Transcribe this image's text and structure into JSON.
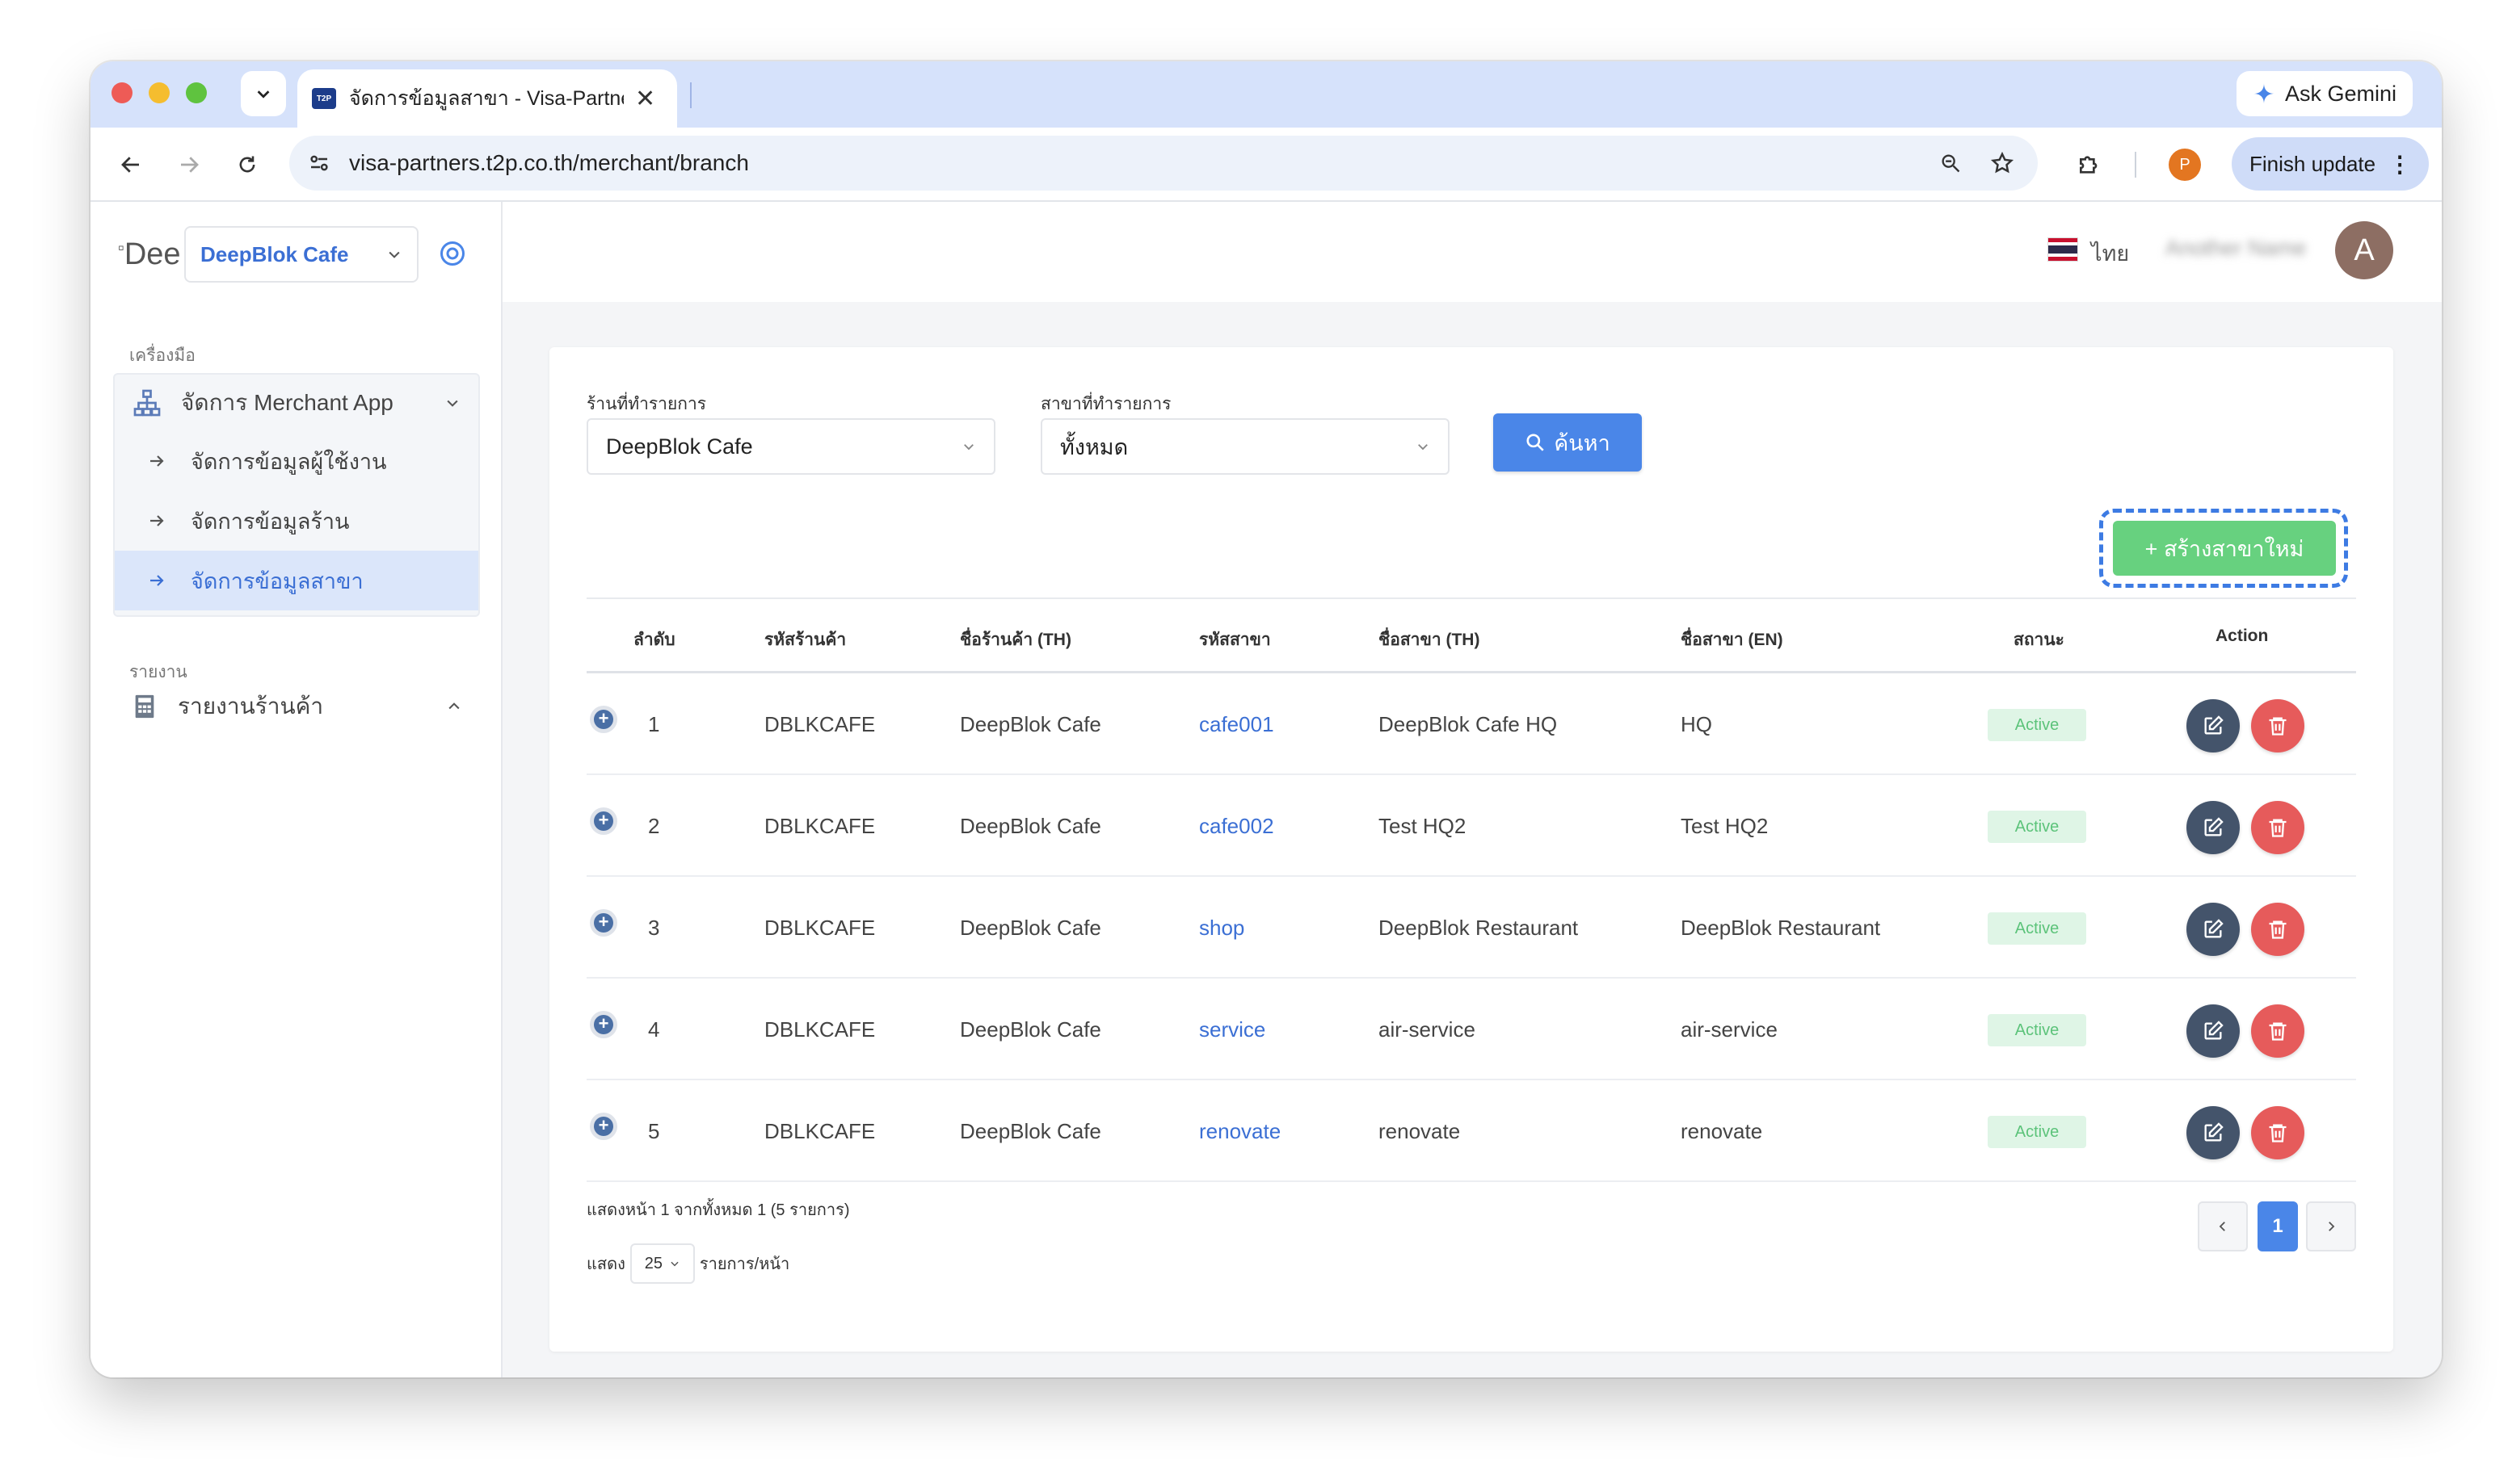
{
  "browser": {
    "tab_title": "จัดการข้อมูลสาขา - Visa-Partners",
    "tab_favicon_text": "T2P",
    "url": "visa-partners.t2p.co.th/merchant/branch",
    "ask_gemini": "Ask Gemini",
    "profile_initial": "P",
    "finish_update": "Finish update"
  },
  "sidebar": {
    "logo_alt": "DeepBlok",
    "store_name": "DeepBlok Cafe",
    "section_tools": "เครื่องมือ",
    "group_label": "จัดการ Merchant App",
    "sub_items": [
      {
        "label": "จัดการข้อมูลผู้ใช้งาน"
      },
      {
        "label": "จัดการข้อมูลร้าน"
      },
      {
        "label": "จัดการข้อมูลสาขา"
      }
    ],
    "section_reports": "รายงาน",
    "report_label": "รายงานร้านค้า"
  },
  "header": {
    "language": "ไทย",
    "user_name": "Another Name",
    "avatar_initial": "A"
  },
  "filters": {
    "store_label": "ร้านที่ทำรายการ",
    "store_value": "DeepBlok Cafe",
    "branch_label": "สาขาที่ทำรายการ",
    "branch_value": "ทั้งหมด",
    "search_button": "ค้นหา"
  },
  "create_button": "+ สร้างสาขาใหม่",
  "table": {
    "columns": [
      "ลำดับ",
      "รหัสร้านค้า",
      "ชื่อร้านค้า (TH)",
      "รหัสสาขา",
      "ชื่อสาขา (TH)",
      "ชื่อสาขา (EN)",
      "สถานะ",
      "Action"
    ],
    "rows": [
      {
        "no": "1",
        "merchant_code": "DBLKCAFE",
        "merchant_name": "DeepBlok Cafe",
        "branch_code": "cafe001",
        "branch_th": "DeepBlok Cafe HQ",
        "branch_en": "HQ",
        "status": "Active"
      },
      {
        "no": "2",
        "merchant_code": "DBLKCAFE",
        "merchant_name": "DeepBlok Cafe",
        "branch_code": "cafe002",
        "branch_th": "Test HQ2",
        "branch_en": "Test HQ2",
        "status": "Active"
      },
      {
        "no": "3",
        "merchant_code": "DBLKCAFE",
        "merchant_name": "DeepBlok Cafe",
        "branch_code": "shop",
        "branch_th": "DeepBlok Restaurant",
        "branch_en": "DeepBlok Restaurant",
        "status": "Active"
      },
      {
        "no": "4",
        "merchant_code": "DBLKCAFE",
        "merchant_name": "DeepBlok Cafe",
        "branch_code": "service",
        "branch_th": "air-service",
        "branch_en": "air-service",
        "status": "Active"
      },
      {
        "no": "5",
        "merchant_code": "DBLKCAFE",
        "merchant_name": "DeepBlok Cafe",
        "branch_code": "renovate",
        "branch_th": "renovate",
        "branch_en": "renovate",
        "status": "Active"
      }
    ]
  },
  "footer": {
    "page_info": "แสดงหน้า 1 จากทั้งหมด 1 (5 รายการ)",
    "show_label": "แสดง",
    "page_size": "25",
    "per_page_label": "รายการ/หน้า",
    "current_page": "1"
  },
  "colors": {
    "primary": "#4a86e8",
    "create_green": "#67d17f",
    "active_badge": "#5cc37a",
    "delete_red": "#e65b5b",
    "edit_slate": "#44546b"
  }
}
